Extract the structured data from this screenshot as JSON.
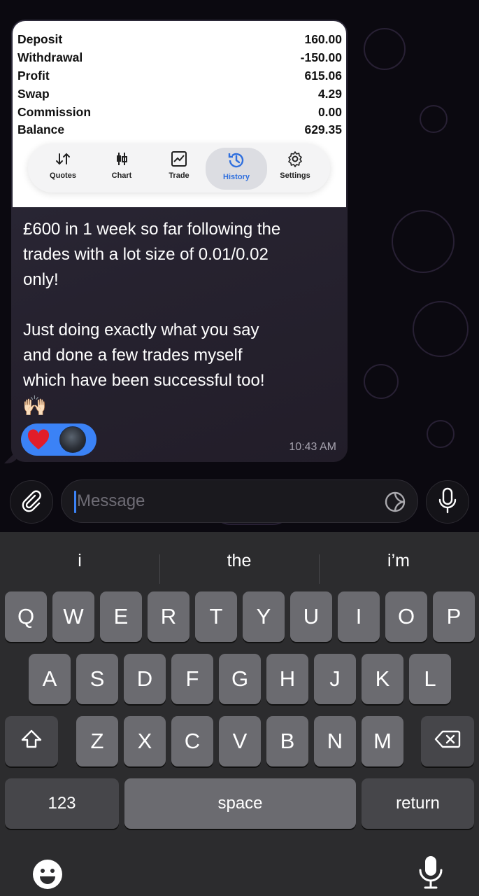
{
  "statement": {
    "rows": [
      {
        "label": "Deposit",
        "value": "160.00"
      },
      {
        "label": "Withdrawal",
        "value": "-150.00"
      },
      {
        "label": "Profit",
        "value": "615.06"
      },
      {
        "label": "Swap",
        "value": "4.29"
      },
      {
        "label": "Commission",
        "value": "0.00"
      },
      {
        "label": "Balance",
        "value": "629.35"
      }
    ],
    "tabs": [
      {
        "label": "Quotes",
        "icon": "quotes-arrows-icon"
      },
      {
        "label": "Chart",
        "icon": "candlestick-icon"
      },
      {
        "label": "Trade",
        "icon": "trade-chart-icon"
      },
      {
        "label": "History",
        "icon": "history-clock-icon",
        "active": true
      },
      {
        "label": "Settings",
        "icon": "gear-icon"
      }
    ],
    "active_color": "#2f6fde"
  },
  "message": {
    "line1": "£600 in 1 week so far following the",
    "line2": "trades with a lot size of 0.01/0.02",
    "line3": "only!",
    "line4": "Just doing exactly what you say",
    "line5": "and done a few trades myself",
    "line6": "which have been successful too!",
    "emoji": "🙌🏻",
    "time": "10:43 AM",
    "reaction": "heart-icon"
  },
  "composer": {
    "placeholder": "Message"
  },
  "keyboard": {
    "suggestions": [
      "i",
      "the",
      "i’m"
    ],
    "row1": [
      "Q",
      "W",
      "E",
      "R",
      "T",
      "Y",
      "U",
      "I",
      "O",
      "P"
    ],
    "row2": [
      "A",
      "S",
      "D",
      "F",
      "G",
      "H",
      "J",
      "K",
      "L"
    ],
    "row3": [
      "Z",
      "X",
      "C",
      "V",
      "B",
      "N",
      "M"
    ],
    "numbers_label": "123",
    "space_label": "space",
    "return_label": "return"
  },
  "colors": {
    "accent": "#3b82f6",
    "bubble": "#2a2634",
    "key": "#6b6b70",
    "keyboard_bg": "#2c2c2e"
  }
}
